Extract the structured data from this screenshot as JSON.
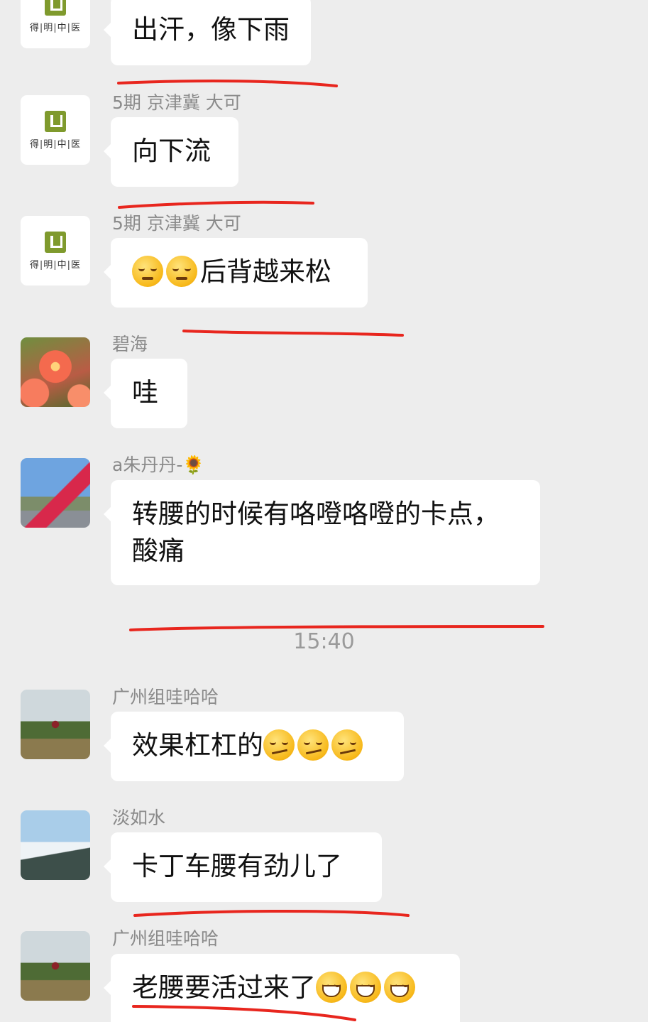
{
  "messages": [
    {
      "sender": "",
      "text": "出汗，像下雨",
      "avatar": "logo"
    },
    {
      "sender": "5期 京津冀 大可",
      "text": "向下流",
      "avatar": "logo"
    },
    {
      "sender": "5期 京津冀 大可",
      "text": "后背越来松",
      "emojis": [
        "thinking-face",
        "thinking-face"
      ],
      "avatar": "logo"
    },
    {
      "sender": "碧海",
      "text": "哇",
      "avatar": "flower-photo"
    },
    {
      "sender": "a朱丹丹-🌻",
      "text_line1": "转腰的时候有咯噔咯噔的卡点，",
      "text_line2": "酸痛",
      "avatar": "flag-photo"
    },
    {
      "sender": "广州组哇哈哈",
      "text": "效果杠杠的",
      "emojis": [
        "smirk-face",
        "smirk-face",
        "smirk-face"
      ],
      "avatar": "man-photo"
    },
    {
      "sender": "淡如水",
      "text": "卡丁车腰有劲儿了",
      "avatar": "mist-photo"
    },
    {
      "sender": "广州组哇哈哈",
      "text": "老腰要活过来了",
      "emojis": [
        "grin-face",
        "grin-face",
        "grin-face"
      ],
      "avatar": "man-photo"
    }
  ],
  "timestamp": "15:40",
  "logo": {
    "text": "得|明|中|医"
  },
  "colors": {
    "background": "#ededed",
    "bubble": "#ffffff",
    "underline": "#e8261e",
    "logo_green": "#7f9a2d"
  }
}
